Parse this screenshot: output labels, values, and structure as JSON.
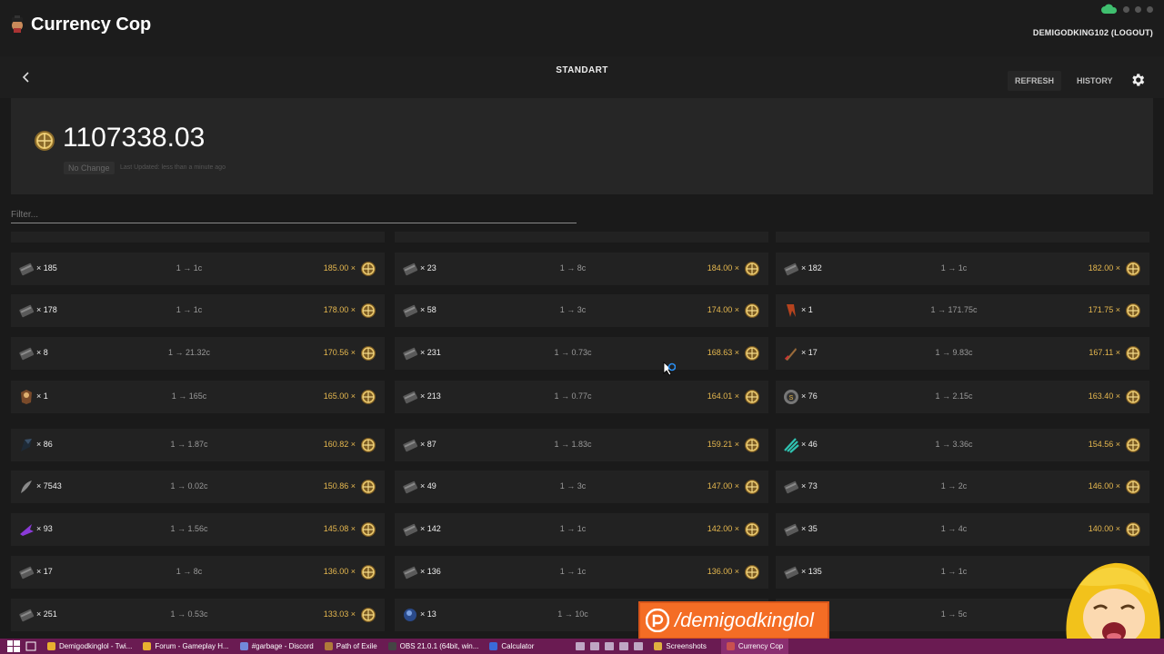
{
  "app": {
    "title": "Currency Cop",
    "user": "DEMIGODKING102 (LOGOUT)"
  },
  "subbar": {
    "league": "STANDART",
    "refresh_label": "REFRESH",
    "history_label": "HISTORY"
  },
  "summary": {
    "total": "1107338.03",
    "change": "No Change",
    "updated": "Last Updated: less than a minute ago"
  },
  "filter": {
    "placeholder": "Filter..."
  },
  "colors": {
    "accent": "#e6b84f",
    "background": "#1a1a1a",
    "card": "#222222",
    "taskbar": "#6a1b52",
    "patreon": "#f46d25"
  },
  "rows": [
    [
      {
        "icon": "scroll-icon",
        "count": "× 185",
        "rate": "1 → 1c",
        "value": "185.00 ×"
      },
      {
        "icon": "scroll-icon",
        "count": "× 23",
        "rate": "1 → 8c",
        "value": "184.00 ×"
      },
      {
        "icon": "scroll-icon",
        "count": "× 182",
        "rate": "1 → 1c",
        "value": "182.00 ×"
      }
    ],
    [
      {
        "icon": "scroll-icon",
        "count": "× 178",
        "rate": "1 → 1c",
        "value": "178.00 ×"
      },
      {
        "icon": "scroll-icon",
        "count": "× 58",
        "rate": "1 → 3c",
        "value": "174.00 ×"
      },
      {
        "icon": "red-claw-icon",
        "count": "× 1",
        "rate": "1 → 171.75c",
        "value": "171.75 ×"
      }
    ],
    [
      {
        "icon": "scroll-icon",
        "count": "× 8",
        "rate": "1 → 21.32c",
        "value": "170.56 ×"
      },
      {
        "icon": "scroll-icon",
        "count": "× 231",
        "rate": "1 → 0.73c",
        "value": "168.63 ×"
      },
      {
        "icon": "dagger-icon",
        "count": "× 17",
        "rate": "1 → 9.83c",
        "value": "167.11 ×"
      }
    ],
    [
      {
        "icon": "armor-icon",
        "count": "× 1",
        "rate": "1 → 165c",
        "value": "165.00 ×"
      },
      {
        "icon": "scroll-icon",
        "count": "× 213",
        "rate": "1 → 0.77c",
        "value": "164.01 ×"
      },
      {
        "icon": "coin-icon",
        "count": "× 76",
        "rate": "1 → 2.15c",
        "value": "163.40 ×"
      }
    ],
    [
      {
        "icon": "dark-gem-icon",
        "count": "× 86",
        "rate": "1 → 1.87c",
        "value": "160.82 ×"
      },
      {
        "icon": "scroll-icon",
        "count": "× 87",
        "rate": "1 → 1.83c",
        "value": "159.21 ×"
      },
      {
        "icon": "teal-claw-icon",
        "count": "× 46",
        "rate": "1 → 3.36c",
        "value": "154.56 ×"
      }
    ],
    [
      {
        "icon": "feather-icon",
        "count": "× 7543",
        "rate": "1 → 0.02c",
        "value": "150.86 ×"
      },
      {
        "icon": "scroll-icon",
        "count": "× 49",
        "rate": "1 → 3c",
        "value": "147.00 ×"
      },
      {
        "icon": "scroll-icon",
        "count": "× 73",
        "rate": "1 → 2c",
        "value": "146.00 ×"
      }
    ],
    [
      {
        "icon": "purple-shard-icon",
        "count": "× 93",
        "rate": "1 → 1.56c",
        "value": "145.08 ×"
      },
      {
        "icon": "scroll-icon",
        "count": "× 142",
        "rate": "1 → 1c",
        "value": "142.00 ×"
      },
      {
        "icon": "scroll-icon",
        "count": "× 35",
        "rate": "1 → 4c",
        "value": "140.00 ×"
      }
    ],
    [
      {
        "icon": "scroll-icon",
        "count": "× 17",
        "rate": "1 → 8c",
        "value": "136.00 ×"
      },
      {
        "icon": "scroll-icon",
        "count": "× 136",
        "rate": "1 → 1c",
        "value": "136.00 ×"
      },
      {
        "icon": "scroll-icon",
        "count": "× 135",
        "rate": "1 → 1c",
        "value": ""
      }
    ],
    [
      {
        "icon": "scroll-icon",
        "count": "× 251",
        "rate": "1 → 0.53c",
        "value": "133.03 ×"
      },
      {
        "icon": "blue-orb-icon",
        "count": "× 13",
        "rate": "1 → 10c",
        "value": ""
      },
      {
        "icon": "",
        "count": "",
        "rate": "1 → 5c",
        "value": ""
      }
    ]
  ],
  "overlay": {
    "patreon": "/demigodkinglol"
  },
  "taskbar": {
    "items": [
      {
        "label": "Demigodkinglol - Twi...",
        "icon": "chrome-icon"
      },
      {
        "label": "Forum - Gameplay H...",
        "icon": "chrome-icon"
      },
      {
        "label": "#garbage - Discord",
        "icon": "discord-icon"
      },
      {
        "label": "Path of Exile",
        "icon": "poe-icon"
      },
      {
        "label": "OBS 21.0.1 (64bit, win...",
        "icon": "obs-icon"
      },
      {
        "label": "Calculator",
        "icon": "calculator-icon"
      },
      {
        "label": "Screenshots",
        "icon": "folder-icon"
      },
      {
        "label": "Currency Cop",
        "icon": "currency-cop-icon"
      }
    ]
  }
}
